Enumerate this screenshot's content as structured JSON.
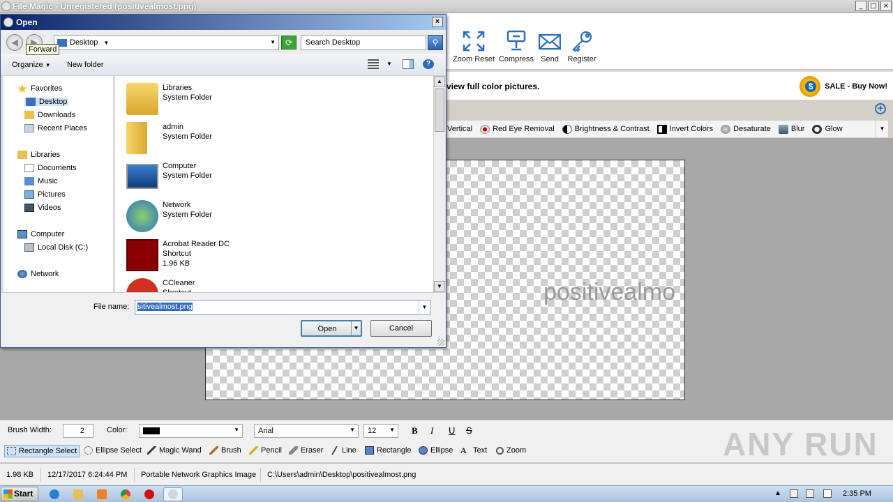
{
  "app": {
    "title": "File Magic - Unregistered (positivealmost.png)",
    "window_controls": [
      "_",
      "□",
      "×"
    ]
  },
  "ribbon": {
    "buttons": [
      {
        "label": "Zoom Reset",
        "icon": "zoom-reset-icon"
      },
      {
        "label": "Compress",
        "icon": "compress-icon"
      },
      {
        "label": "Send",
        "icon": "mail-icon"
      },
      {
        "label": "Register",
        "icon": "key-icon"
      }
    ]
  },
  "sale": {
    "message": "view full color pictures.",
    "button": "SALE - Buy Now!",
    "coin": "$"
  },
  "add_symbol": "+",
  "effects": [
    {
      "label": "Vertical"
    },
    {
      "label": "Red Eye Removal"
    },
    {
      "label": "Brightness & Contrast"
    },
    {
      "label": "Invert Colors"
    },
    {
      "label": "Desaturate"
    },
    {
      "label": "Blur"
    },
    {
      "label": "Glow"
    }
  ],
  "canvas": {
    "watermark_text": "positivealmo"
  },
  "tool_options": {
    "brush_width_label": "Brush Width:",
    "brush_width_value": "2",
    "color_label": "Color:",
    "color_value": "#000000",
    "font": "Arial",
    "font_size": "12",
    "format_buttons": [
      "B",
      "I",
      "U",
      "S"
    ]
  },
  "tools": [
    "Rectangle Select",
    "Ellipse Select",
    "Magic Wand",
    "Brush",
    "Pencil",
    "Eraser",
    "Line",
    "Rectangle",
    "Ellipse",
    "Text",
    "Zoom"
  ],
  "status": {
    "size": "1.98 KB",
    "date": "12/17/2017 6:24:44 PM",
    "type": "Portable Network Graphics Image",
    "path": "C:\\Users\\admin\\Desktop\\positivealmost.png"
  },
  "taskbar": {
    "start": "Start",
    "clock": "2:35 PM"
  },
  "dialog": {
    "title": "Open",
    "close": "×",
    "tooltip": "Forward",
    "address": "Desktop",
    "search_placeholder": "Search Desktop",
    "organize": "Organize",
    "new_folder": "New folder",
    "nav": {
      "favorites": "Favorites",
      "favorites_items": [
        "Desktop",
        "Downloads",
        "Recent Places"
      ],
      "libraries": "Libraries",
      "libraries_items": [
        "Documents",
        "Music",
        "Pictures",
        "Videos"
      ],
      "computer": "Computer",
      "computer_items": [
        "Local Disk (C:)"
      ],
      "network": "Network"
    },
    "files": [
      {
        "name": "Libraries",
        "type": "System Folder",
        "size": ""
      },
      {
        "name": "admin",
        "type": "System Folder",
        "size": ""
      },
      {
        "name": "Computer",
        "type": "System Folder",
        "size": ""
      },
      {
        "name": "Network",
        "type": "System Folder",
        "size": ""
      },
      {
        "name": "Acrobat Reader DC",
        "type": "Shortcut",
        "size": "1.96 KB"
      },
      {
        "name": "CCleaner",
        "type": "Shortcut",
        "size": ""
      }
    ],
    "file_name_label": "File name:",
    "file_name_value": "sitivealmost.png",
    "open": "Open",
    "cancel": "Cancel"
  },
  "watermark_brand": "ANY RUN"
}
